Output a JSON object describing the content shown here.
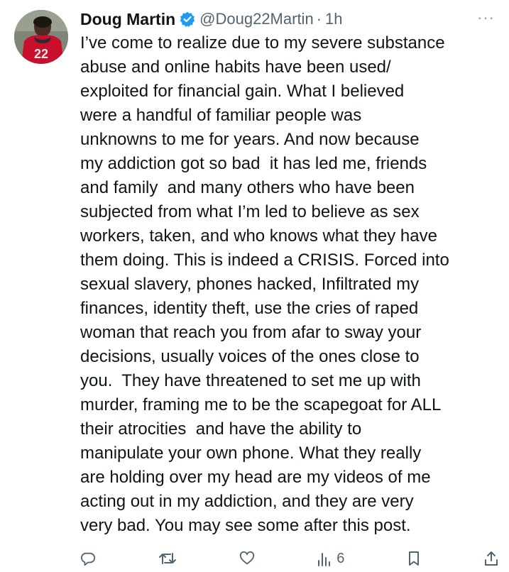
{
  "tweet": {
    "author": {
      "display_name": "Doug Martin",
      "handle": "@Doug22Martin",
      "separator": "·",
      "time": "1h",
      "verified": true,
      "jersey_number": "22"
    },
    "more_label": "···",
    "text_lines": [
      "I’ve come to realize due to my severe substance",
      "abuse and online habits have been used/",
      "exploited for financial gain. What I believed",
      "were a handful of familiar people was",
      "unknowns to me for years. And now because",
      "my addiction got so bad  it has led me, friends",
      "and family  and many others who have been",
      "subjected from what I’m led to believe as sex",
      "workers, taken, and who knows what they have",
      "them doing. This is indeed a CRISIS. Forced into",
      "sexual slavery, phones hacked, Infiltrated my",
      "finances, identity theft, use the cries of raped",
      "woman that reach you from afar to sway your",
      "decisions, usually voices of the ones close to",
      "you.  They have threatened to set me up with",
      "murder, framing me to be the scapegoat for ALL",
      "their atrocities  and have the ability to",
      "manipulate your own phone. What they really",
      "are holding over my head are my videos of me",
      "acting out in my addiction, and they are very",
      "very bad. You may see some after this post."
    ],
    "actions": {
      "reply_icon": "reply-icon",
      "retweet_icon": "retweet-icon",
      "like_icon": "like-icon",
      "views_icon": "views-icon",
      "views_count": "6",
      "bookmark_icon": "bookmark-icon",
      "share_icon": "share-icon"
    },
    "colors": {
      "text": "#0f1419",
      "secondary": "#536471",
      "verified": "#1d9bf0",
      "jersey": "#c8102e"
    }
  }
}
